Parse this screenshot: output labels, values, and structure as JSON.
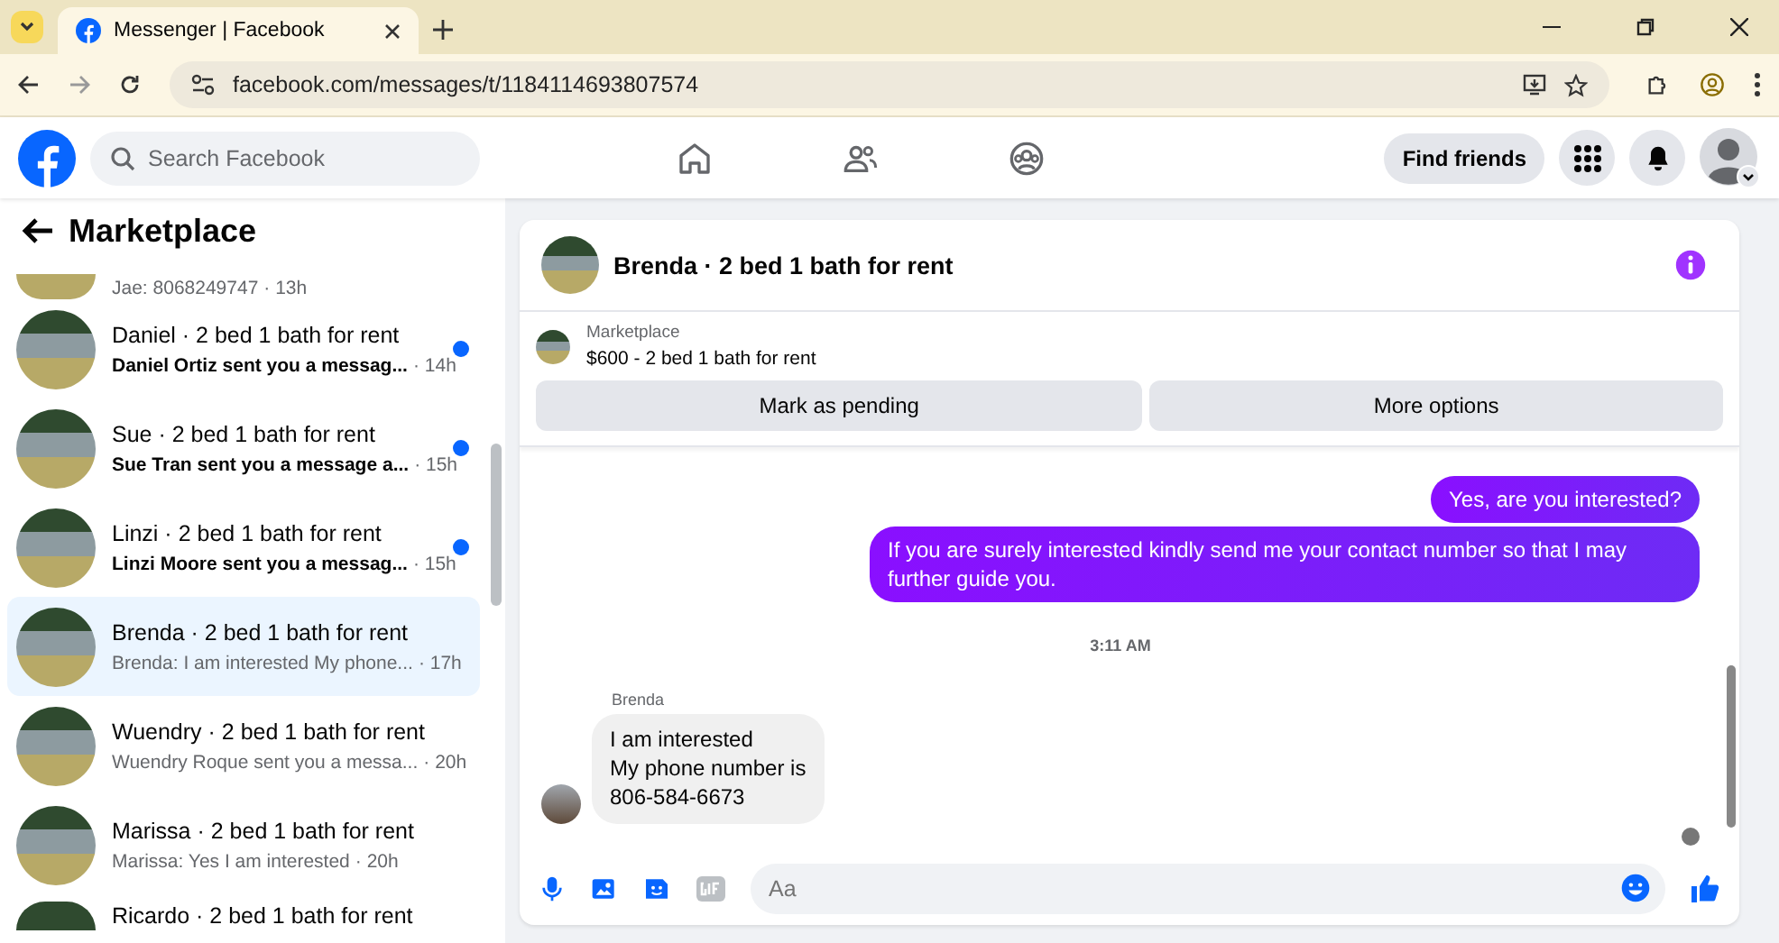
{
  "browser": {
    "tab_title": "Messenger | Facebook",
    "url": "facebook.com/messages/t/1184114693807574"
  },
  "topbar": {
    "search": {
      "placeholder": "Search Facebook"
    },
    "find_friends": "Find friends"
  },
  "sidebar": {
    "title": "Marketplace",
    "items": [
      {
        "preview": "Jae: 8068249747",
        "time": "· 13h",
        "unread": false,
        "selected": false
      },
      {
        "title": "Daniel · 2 bed 1 bath for rent",
        "preview": "Daniel Ortiz sent you a messag...",
        "time": "· 14h",
        "unread": true,
        "selected": false
      },
      {
        "title": "Sue · 2 bed 1 bath for rent",
        "preview": "Sue Tran sent you a message a...",
        "time": "· 15h",
        "unread": true,
        "selected": false
      },
      {
        "title": "Linzi · 2 bed 1 bath for rent",
        "preview": "Linzi Moore sent you a messag...",
        "time": "· 15h",
        "unread": true,
        "selected": false
      },
      {
        "title": "Brenda · 2 bed 1 bath for rent",
        "preview": "Brenda: I am interested My phone...",
        "time": "· 17h",
        "unread": false,
        "selected": true
      },
      {
        "title": "Wuendry · 2 bed 1 bath for rent",
        "preview": "Wuendry Roque sent you a messa...",
        "time": "· 20h",
        "unread": false,
        "selected": false
      },
      {
        "title": "Marissa · 2 bed 1 bath for rent",
        "preview": "Marissa: Yes I am interested",
        "time": "· 20h",
        "unread": false,
        "selected": false
      },
      {
        "title": "Ricardo · 2 bed 1 bath for rent",
        "unread": false,
        "selected": false
      }
    ]
  },
  "chat": {
    "title": "Brenda · 2 bed 1 bath for rent",
    "listing": {
      "source": "Marketplace",
      "title": "$600 - 2 bed 1 bath for rent"
    },
    "buttons": [
      "Mark as pending",
      "More options"
    ],
    "messages": [
      {
        "kind": "sent",
        "text": "Yes, are you interested?"
      },
      {
        "kind": "sent",
        "text": "If you are surely interested kindly send me your contact number so that I may further guide you."
      },
      {
        "kind": "time",
        "text": "3:11 AM"
      },
      {
        "kind": "received",
        "sender": "Brenda",
        "text": "I am interested\nMy phone number is\n806-584-6673"
      }
    ],
    "composer": {
      "placeholder": "Aa"
    }
  }
}
